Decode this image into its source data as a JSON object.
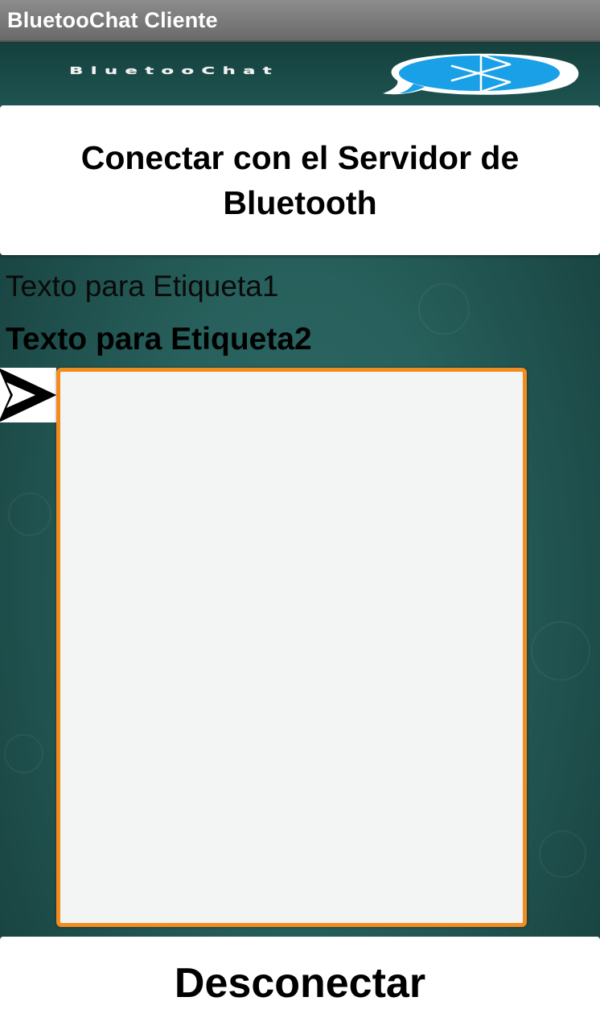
{
  "app": {
    "title": "BluetooChat Cliente"
  },
  "banner": {
    "wordmark": "BluetooChat"
  },
  "buttons": {
    "connect_label": "Conectar con el Servidor de Bluetooth",
    "disconnect_label": "Desconectar"
  },
  "labels": {
    "label1": "Texto para Etiqueta1",
    "label2": "Texto para Etiqueta2"
  },
  "icons": {
    "banner_logo": "bluetooth-chat-bubble-icon",
    "send_arrow": "send-arrow-icon"
  },
  "colors": {
    "titlebar": "#7a7a7a",
    "background": "#27605c",
    "chat_border": "#f28c1e",
    "bubble": "#1aa0e6"
  }
}
